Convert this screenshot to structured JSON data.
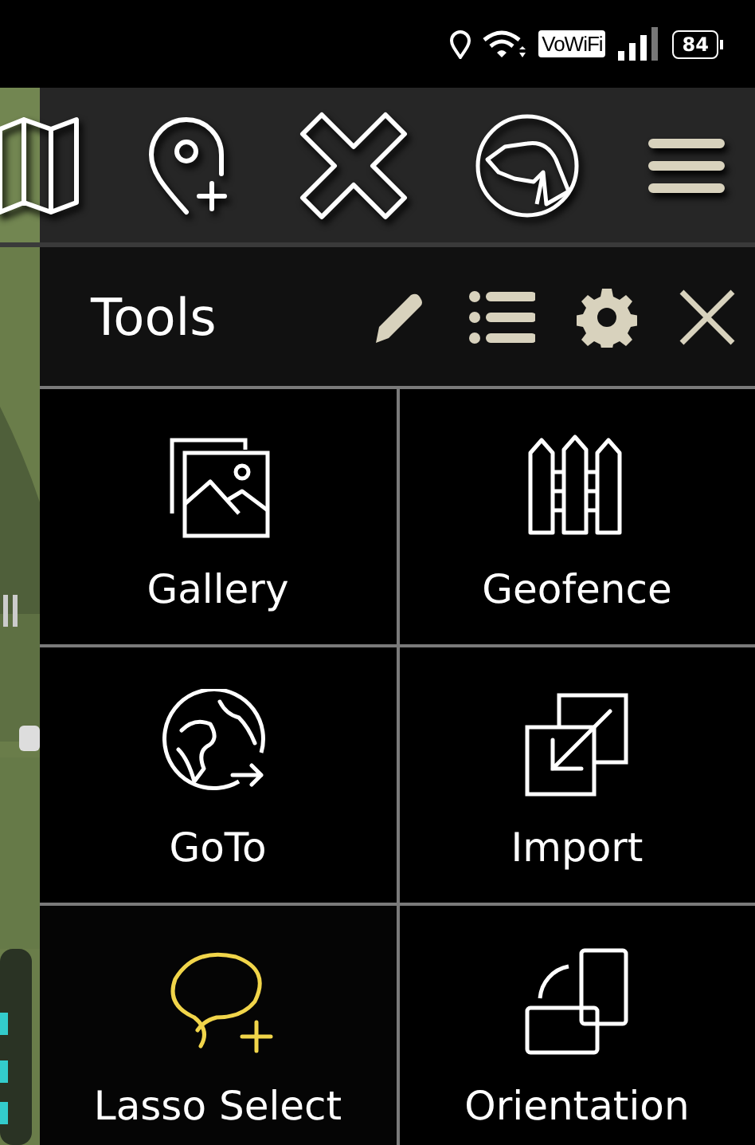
{
  "status_bar": {
    "badge": "VoWiFi",
    "battery": "84"
  },
  "panel": {
    "title": "Tools",
    "tools": [
      {
        "label": "Gallery",
        "kind": "gallery",
        "selected": false
      },
      {
        "label": "Geofence",
        "kind": "geofence",
        "selected": false
      },
      {
        "label": "GoTo",
        "kind": "goto",
        "selected": false
      },
      {
        "label": "Import",
        "kind": "import",
        "selected": false
      },
      {
        "label": "Lasso Select",
        "kind": "lasso",
        "selected": true
      },
      {
        "label": "Orientation",
        "kind": "orientation",
        "selected": false
      }
    ]
  }
}
